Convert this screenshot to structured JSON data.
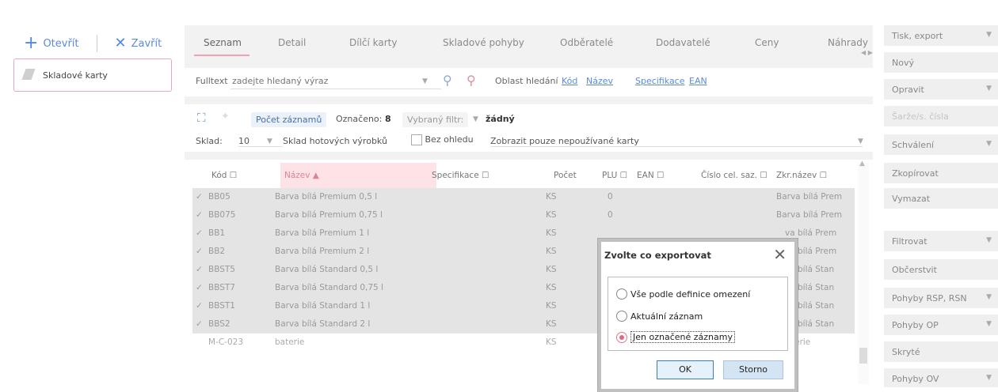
{
  "left": {
    "open_label": "Otevřít",
    "close_label": "Zavřít",
    "item_label": "Skladové karty"
  },
  "tabs": [
    "Seznam",
    "Detail",
    "Dílčí karty",
    "Skladové pohyby",
    "Odběratelé",
    "Dodavatelé",
    "Ceny",
    "Náhrady"
  ],
  "search": {
    "label": "Fulltext",
    "placeholder": "zadejte hledaný výraz",
    "area_label": "Oblast hledání",
    "areas": [
      "Kód",
      "Název",
      "Specifikace",
      "EAN"
    ]
  },
  "toolbar": {
    "count_label": "Počet záznamů",
    "marked_label": "Označeno:",
    "marked_value": "8",
    "filter_label": "Vybraný filtr:",
    "filter_value": "žádný",
    "sklad_label": "Sklad:",
    "sklad_code": "10",
    "sklad_name": "Sklad hotových výrobků",
    "no_move_label": "Bez ohledu",
    "unused_label": "Zobrazit pouze nepoužívané karty"
  },
  "table": {
    "columns": [
      "Kód ☐",
      "Název ▲",
      "Specifikace ☐",
      "Počet",
      "PLU ☐",
      "EAN ☐",
      "Číslo cel. saz. ☐",
      "Zkr.název ☐"
    ],
    "rows": [
      {
        "check": "✓",
        "code": "BB05",
        "name": "Barva bílá Premium 0,5 l",
        "unit": "KS",
        "plu": "0",
        "short": "Barva bílá Prem"
      },
      {
        "check": "✓",
        "code": "BB075",
        "name": "Barva bílá Premium 0,75 l",
        "unit": "KS",
        "plu": "0",
        "short": "Barva bílá Prem"
      },
      {
        "check": "✓",
        "code": "BB1",
        "name": "Barva bílá Premium 1 l",
        "unit": "KS",
        "plu": "",
        "short": "va bílá Prem"
      },
      {
        "check": "✓",
        "code": "BB2",
        "name": "Barva bílá Premium 2 l",
        "unit": "KS",
        "plu": "",
        "short": "va bílá Prem"
      },
      {
        "check": "✓",
        "code": "BBST5",
        "name": "Barva bílá Standard 0,5 l",
        "unit": "KS",
        "plu": "",
        "short": "va bílá Stan"
      },
      {
        "check": "✓",
        "code": "BBST7",
        "name": "Barva bílá Standard 0,75 l",
        "unit": "KS",
        "plu": "",
        "short": "va bílá Stan"
      },
      {
        "check": "✓",
        "code": "BBST1",
        "name": "Barva bílá Standard 1 l",
        "unit": "KS",
        "plu": "",
        "short": "va bílá Stan"
      },
      {
        "check": "✓",
        "code": "BBS2",
        "name": "Barva bílá Standard 2 l",
        "unit": "KS",
        "plu": "",
        "short": "va bílá Stan"
      },
      {
        "check": "",
        "code": "M-C-023",
        "name": "baterie",
        "unit": "KS",
        "plu": "",
        "short": "terie"
      }
    ]
  },
  "right_buttons": [
    {
      "label": "Tisk, export",
      "arrow": true
    },
    {
      "label": "Nový",
      "arrow": false
    },
    {
      "label": "Opravit",
      "arrow": true
    },
    {
      "label": "Šarže/s. čísla",
      "arrow": false
    },
    {
      "label": "Schválení",
      "arrow": true
    },
    {
      "label": "Zkopírovat",
      "arrow": false
    },
    {
      "label": "Vymazat",
      "arrow": false
    },
    {
      "label": "Filtrovat",
      "arrow": true
    },
    {
      "label": "Občerstvit",
      "arrow": false
    },
    {
      "label": "Pohyby RSP, RSN",
      "arrow": true
    },
    {
      "label": "Pohyby OP",
      "arrow": true
    },
    {
      "label": "Skryté",
      "arrow": false
    },
    {
      "label": "Pohyby OV",
      "arrow": true
    }
  ],
  "dialog": {
    "title": "Zvolte co exportovat",
    "options": [
      "Vše podle definice omezení",
      "Aktuální záznam",
      "Jen označené záznamy"
    ],
    "selected_index": 2,
    "ok_label": "OK",
    "cancel_label": "Storno"
  }
}
